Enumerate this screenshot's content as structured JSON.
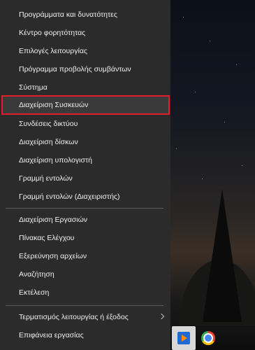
{
  "menu": {
    "items": [
      {
        "label": "Προγράμματα και δυνατότητες"
      },
      {
        "label": "Κέντρο φορητότητας"
      },
      {
        "label": "Επιλογές λειτουργίας"
      },
      {
        "label": "Πρόγραμμα προβολής συμβάντων"
      },
      {
        "label": "Σύστημα"
      },
      {
        "label": "Διαχείριση Συσκευών"
      },
      {
        "label": "Συνδέσεις δικτύου"
      },
      {
        "label": "Διαχείριση δίσκων"
      },
      {
        "label": "Διαχείριση υπολογιστή"
      },
      {
        "label": "Γραμμή εντολών"
      },
      {
        "label": "Γραμμή εντολών (Διαχειριστής)"
      },
      {
        "label": "Διαχείριση Εργασιών"
      },
      {
        "label": "Πίνακας Ελέγχου"
      },
      {
        "label": "Εξερεύνηση αρχείων"
      },
      {
        "label": "Αναζήτηση"
      },
      {
        "label": "Εκτέλεση"
      },
      {
        "label": "Τερματισμός λειτουργίας ή έξοδος"
      },
      {
        "label": "Επιφάνεια εργασίας"
      }
    ],
    "highlighted_item": "Διαχείριση Συσκευών",
    "highlight_color": "#e21e26",
    "submenu_icon": "chevron-right-icon"
  },
  "taskbar": {
    "icons": [
      "media-player-icon",
      "chrome-icon"
    ]
  }
}
